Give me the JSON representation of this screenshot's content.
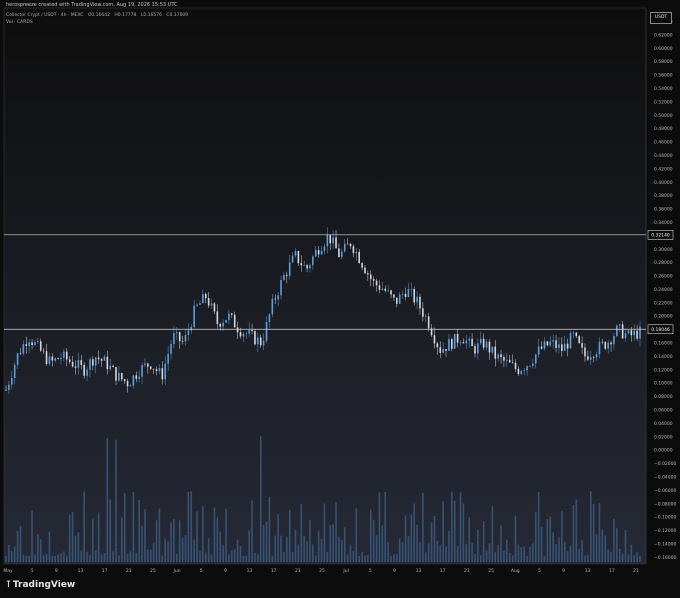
{
  "header": {
    "created_by": "herospreeze created with TradingView.com, Aug 19, 2026 15:53 UTC",
    "symbol_line_prefix": "Collector Crypt / USDT · 4h · MEXC",
    "open": "O0.16642",
    "high": "H0.17778",
    "low": "L0.16576",
    "close": "C0.17609",
    "volume_line": "Vol · CARDS"
  },
  "unit_label": "USDT",
  "brand": "TradingView",
  "colors": {
    "bull": "#5a9fe0",
    "bear": "#d8d8d8",
    "volume": "#3b5a80",
    "hline": "#d8d8d8"
  },
  "chart_data": {
    "type": "line",
    "title": "",
    "xlabel": "",
    "ylabel": "",
    "ylim": [
      -0.17,
      0.66
    ],
    "grid": false,
    "x_ticks": [
      "May",
      "5",
      "9",
      "13",
      "17",
      "21",
      "25",
      "Jun",
      "5",
      "9",
      "13",
      "17",
      "21",
      "25",
      "Jul",
      "5",
      "9",
      "13",
      "17",
      "21",
      "25",
      "Aug",
      "5",
      "9",
      "13",
      "17",
      "21"
    ],
    "y_ticks": [
      "0.64000",
      "0.62000",
      "0.60000",
      "0.58000",
      "0.56000",
      "0.54000",
      "0.52000",
      "0.50000",
      "0.48000",
      "0.46000",
      "0.44000",
      "0.42000",
      "0.40000",
      "0.38000",
      "0.36000",
      "0.34000",
      "0.30000",
      "0.28000",
      "0.26000",
      "0.24000",
      "0.22000",
      "0.20000",
      "0.16000",
      "0.14000",
      "0.12000",
      "0.10000",
      "0.08000",
      "0.06000",
      "0.04000",
      "0.02000",
      "0.00000",
      "−0.02000",
      "−0.04000",
      "−0.06000",
      "−0.08000",
      "−0.10000",
      "−0.12000",
      "−0.14000",
      "−0.16000"
    ],
    "horizontal_lines": [
      {
        "value": 0.3214,
        "label": "0.32140"
      },
      {
        "value": 0.18046,
        "label": "0.18046"
      }
    ],
    "series": [
      {
        "x": [
          0,
          2,
          4,
          6,
          8,
          10,
          12,
          14,
          16,
          18,
          20,
          22,
          24,
          26,
          28,
          30,
          32,
          34,
          36,
          38,
          40,
          42,
          44,
          46,
          48,
          50,
          52,
          54,
          56,
          58,
          60,
          62,
          64,
          66,
          68,
          70,
          72,
          74,
          76,
          78,
          80,
          82,
          84,
          86,
          88,
          90,
          92,
          94,
          96,
          98,
          100,
          102,
          104,
          106,
          108,
          110,
          112,
          114
        ],
        "y": [
          0.09,
          0.14,
          0.17,
          0.15,
          0.13,
          0.14,
          0.13,
          0.12,
          0.14,
          0.13,
          0.11,
          0.1,
          0.12,
          0.13,
          0.11,
          0.17,
          0.16,
          0.21,
          0.23,
          0.19,
          0.2,
          0.18,
          0.17,
          0.16,
          0.22,
          0.26,
          0.29,
          0.27,
          0.3,
          0.32,
          0.29,
          0.31,
          0.28,
          0.25,
          0.24,
          0.22,
          0.24,
          0.22,
          0.19,
          0.15,
          0.16,
          0.17,
          0.15,
          0.16,
          0.14,
          0.13,
          0.12,
          0.13,
          0.15,
          0.16,
          0.15,
          0.17,
          0.14,
          0.15,
          0.16,
          0.18,
          0.17,
          0.176
        ]
      }
    ]
  }
}
